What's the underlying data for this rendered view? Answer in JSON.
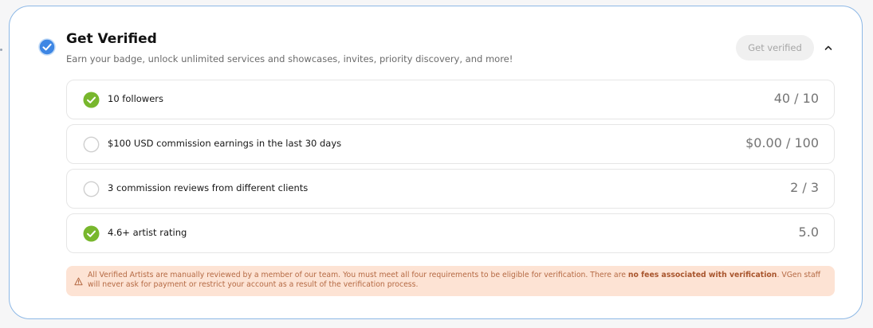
{
  "header": {
    "title": "Get Verified",
    "subtitle": "Earn your badge, unlock unlimited services and showcases, invites, priority discovery, and more!",
    "verify_button_label": "Get verified",
    "badge_icon": "verified-check-icon",
    "collapse_icon": "chevron-up-icon"
  },
  "requirements": [
    {
      "label": "10 followers",
      "progress": "40 / 10",
      "completed": true
    },
    {
      "label": "$100 USD commission earnings in the last 30 days",
      "progress": "$0.00 / 100",
      "completed": false
    },
    {
      "label": "3 commission reviews from different clients",
      "progress": "2 / 3",
      "completed": false
    },
    {
      "label": "4.6+ artist rating",
      "progress": "5.0",
      "completed": true
    }
  ],
  "notice": {
    "text_before": "All Verified Artists are manually reviewed by a member of our team. You must meet all four requirements to be eligible for verification. There are ",
    "emphasis": "no fees associated with verification",
    "text_after": ". VGen staff will never ask for payment or restrict your account as a result of the verification process.",
    "icon": "warning-triangle-icon"
  },
  "colors": {
    "accent_border": "#8db8e6",
    "check_green": "#78b72d",
    "badge_blue": "#3d86e4",
    "notice_background": "#fde3d4",
    "notice_text": "#b56a44"
  }
}
